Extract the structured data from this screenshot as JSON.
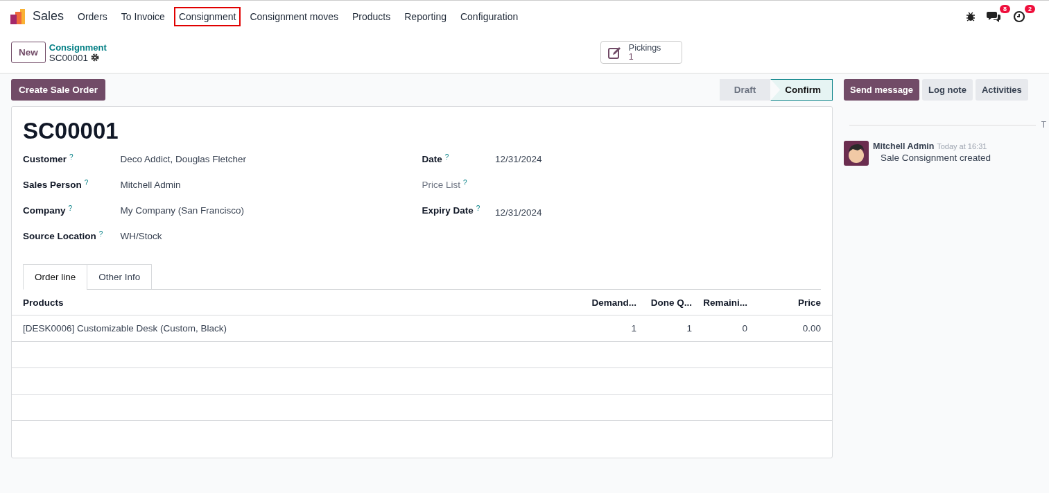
{
  "navbar": {
    "app": "Sales",
    "menu": [
      {
        "label": "Orders",
        "highlighted": false
      },
      {
        "label": "To Invoice",
        "highlighted": false
      },
      {
        "label": "Consignment",
        "highlighted": true
      },
      {
        "label": "Consignment moves",
        "highlighted": false
      },
      {
        "label": "Products",
        "highlighted": false
      },
      {
        "label": "Reporting",
        "highlighted": false
      },
      {
        "label": "Configuration",
        "highlighted": false
      }
    ],
    "messages_badge": "8",
    "activities_badge": "2"
  },
  "control_panel": {
    "new_button": "New",
    "breadcrumb": "Consignment",
    "record": "SC00001",
    "smart_button": {
      "label": "Pickings",
      "count": "1"
    }
  },
  "actions": {
    "primary": "Create Sale Order",
    "statusbar": [
      {
        "label": "Draft",
        "selected": false
      },
      {
        "label": "Confirm",
        "selected": true
      }
    ]
  },
  "form": {
    "title": "SC00001",
    "left_fields": [
      {
        "label": "Customer",
        "value": "Deco Addict, Douglas Fletcher",
        "muted": false
      },
      {
        "label": "Sales Person",
        "value": "Mitchell Admin",
        "muted": false
      },
      {
        "label": "Company",
        "value": "My Company (San Francisco)",
        "muted": false
      },
      {
        "label": "Source Location",
        "value": "WH/Stock",
        "muted": false
      }
    ],
    "right_fields": [
      {
        "label": "Date",
        "value": "12/31/2024",
        "muted": false
      },
      {
        "label": "Price List",
        "muted": true
      },
      {
        "label": "Expiry Date",
        "value": "12/31/2024",
        "muted": false
      }
    ],
    "help_mark": "?",
    "tabs": [
      {
        "label": "Order line",
        "selected": true
      },
      {
        "label": "Other Info",
        "selected": false
      }
    ],
    "table": {
      "columns": [
        "Products",
        "Demand...",
        "Done Q...",
        "Remaini...",
        "Price"
      ],
      "rows": [
        [
          "[DESK0006] Customizable Desk (Custom, Black)",
          "1",
          "1",
          "0",
          "0.00"
        ]
      ]
    }
  },
  "chatter": {
    "buttons": [
      {
        "label": "Send message",
        "selected": true
      },
      {
        "label": "Log note",
        "selected": false
      },
      {
        "label": "Activities",
        "selected": false
      }
    ],
    "divider_label": "T",
    "messages": [
      {
        "author": "Mitchell Admin",
        "time": "Today at 16:31",
        "body": "Sale Consignment created"
      }
    ]
  }
}
